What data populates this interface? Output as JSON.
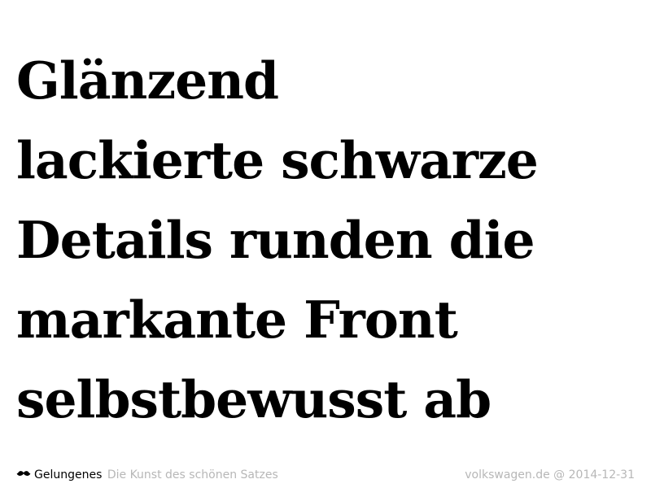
{
  "quote": {
    "lines": [
      "Glänzend",
      "lackierte schwarze",
      "Details runden die",
      "markante Front",
      "selbstbewusst ab"
    ]
  },
  "footer": {
    "icon": "mustache-icon",
    "brand": "Gelungenes",
    "tagline": "Die Kunst des schönen Satzes",
    "source": "volkswagen.de @ 2014-12-31"
  },
  "colors": {
    "text": "#000000",
    "muted": "#b7b7b7",
    "background": "#ffffff"
  }
}
